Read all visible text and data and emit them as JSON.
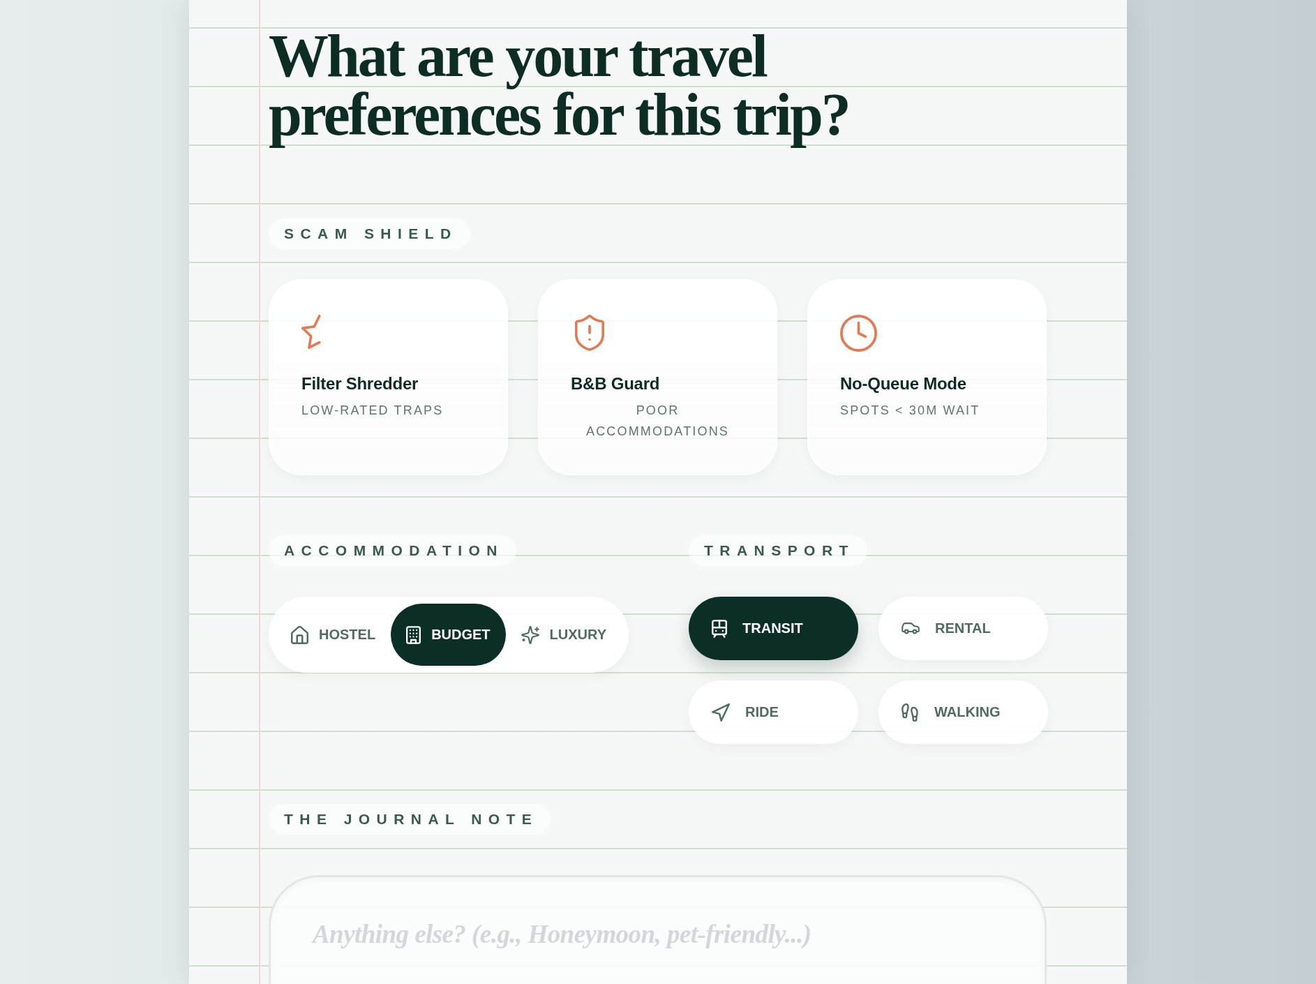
{
  "heading": "What are your travel preferences for this trip?",
  "scam_shield": {
    "label": "SCAM SHIELD",
    "cards": [
      {
        "title": "Filter Shredder",
        "subtitle": "LOW-RATED TRAPS"
      },
      {
        "title": "B&B Guard",
        "subtitle": "POOR ACCOMMODATIONS"
      },
      {
        "title": "No-Queue Mode",
        "subtitle": "SPOTS < 30M WAIT"
      }
    ]
  },
  "accommodation": {
    "label": "ACCOMMODATION",
    "options": [
      {
        "label": "HOSTEL",
        "selected": false
      },
      {
        "label": "BUDGET",
        "selected": true
      },
      {
        "label": "LUXURY",
        "selected": false
      }
    ]
  },
  "transport": {
    "label": "TRANSPORT",
    "options": [
      {
        "label": "TRANSIT",
        "selected": true
      },
      {
        "label": "RENTAL",
        "selected": false
      },
      {
        "label": "RIDE",
        "selected": false
      },
      {
        "label": "WALKING",
        "selected": false
      }
    ]
  },
  "journal_note": {
    "label": "THE JOURNAL NOTE",
    "placeholder": "Anything else? (e.g., Honeymoon, pet-friendly...)"
  }
}
